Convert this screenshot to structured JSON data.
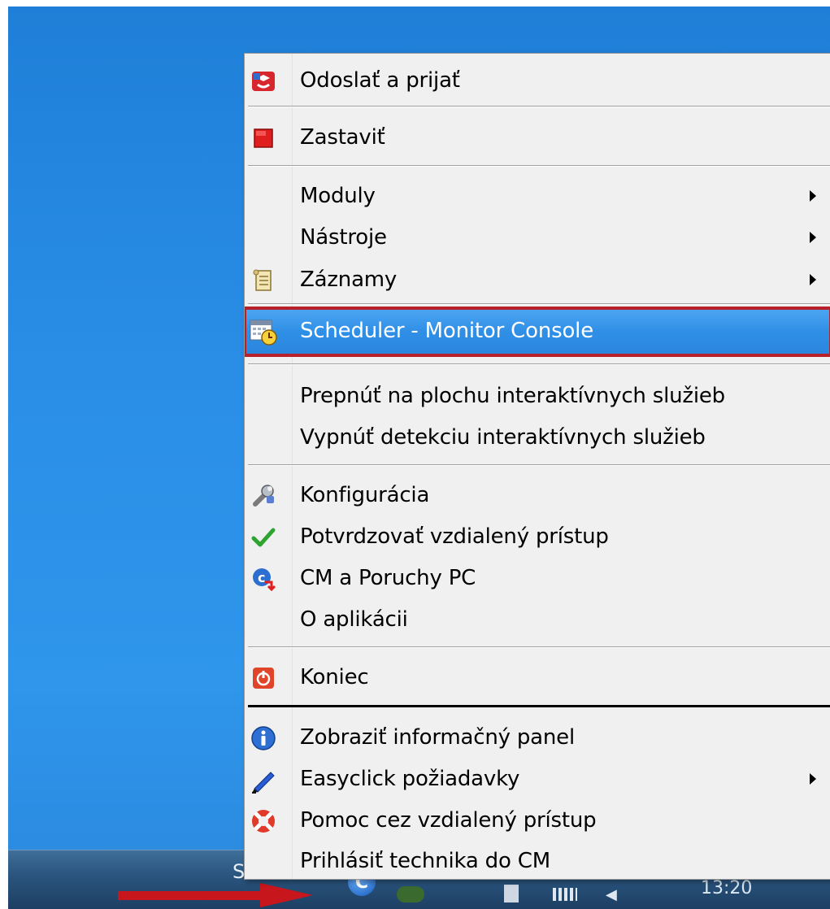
{
  "taskbar": {
    "start_text": "S",
    "clock": "13:20",
    "tray_app_letter": "C"
  },
  "menu": {
    "items": [
      {
        "id": "send",
        "label": "Odoslať a prijať",
        "icon": "send-receive-icon"
      },
      {
        "id": "stop",
        "label": "Zastaviť",
        "icon": "stop-icon"
      },
      {
        "id": "modules",
        "label": "Moduly",
        "icon": "",
        "submenu": true
      },
      {
        "id": "tools",
        "label": "Nástroje",
        "icon": "",
        "submenu": true
      },
      {
        "id": "records",
        "label": "Záznamy",
        "icon": "scroll-icon",
        "submenu": true
      },
      {
        "id": "scheduler",
        "label": "Scheduler - Monitor Console",
        "icon": "scheduler-icon",
        "highlighted": true
      },
      {
        "id": "switch",
        "label": "Prepnúť na plochu interaktívnych služieb",
        "icon": ""
      },
      {
        "id": "disable",
        "label": "Vypnúť detekciu interaktívnych služieb",
        "icon": ""
      },
      {
        "id": "config",
        "label": "Konfigurácia",
        "icon": "wrench-icon"
      },
      {
        "id": "confirm",
        "label": "Potvrdzovať vzdialený prístup",
        "icon": "checkmark-icon"
      },
      {
        "id": "cm",
        "label": "CM a Poruchy PC",
        "icon": "cm-icon"
      },
      {
        "id": "about",
        "label": "O aplikácii",
        "icon": ""
      },
      {
        "id": "exit",
        "label": "Koniec",
        "icon": "power-icon"
      },
      {
        "id": "info",
        "label": "Zobraziť informačný panel",
        "icon": "info-icon"
      },
      {
        "id": "easyclick",
        "label": "Easyclick požiadavky",
        "icon": "pen-icon",
        "submenu": true
      },
      {
        "id": "help",
        "label": "Pomoc cez vzdialený prístup",
        "icon": "lifebuoy-icon"
      },
      {
        "id": "login",
        "label": "Prihlásiť technika do CM",
        "icon": ""
      }
    ]
  },
  "colors": {
    "highlight": "#2f8fe6",
    "highlight_border": "#b8202a",
    "desktop": "#2a8ee6"
  }
}
